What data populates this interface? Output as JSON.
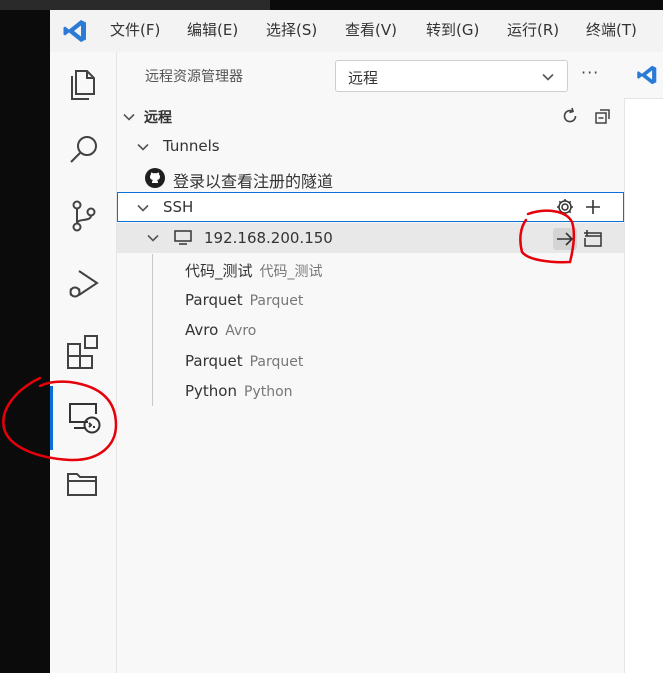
{
  "menu": {
    "file": "文件(F)",
    "edit": "编辑(E)",
    "selection": "选择(S)",
    "view": "查看(V)",
    "go": "转到(G)",
    "run": "运行(R)",
    "terminal": "终端(T)"
  },
  "sidebar": {
    "title": "远程资源管理器",
    "dropdown_value": "远程",
    "more": "···",
    "section_title": "远程",
    "tunnels": {
      "label": "Tunnels",
      "signin_text": "登录以查看注册的隧道"
    },
    "ssh": {
      "label": "SSH",
      "host": "192.168.200.150",
      "folders": [
        {
          "name": "代码_测试",
          "desc": "代码_测试"
        },
        {
          "name": "Parquet",
          "desc": "Parquet"
        },
        {
          "name": "Avro",
          "desc": "Avro"
        },
        {
          "name": "Parquet",
          "desc": "Parquet"
        },
        {
          "name": "Python",
          "desc": "Python"
        }
      ]
    }
  },
  "colors": {
    "accent": "#0a6fd6",
    "vscode_blue": "#2b7bd6",
    "annotation": "#e6000a"
  },
  "icons": [
    "vscode-logo-icon",
    "explorer-icon",
    "search-icon",
    "source-control-icon",
    "run-debug-icon",
    "extensions-icon",
    "remote-explorer-icon",
    "folder-icon",
    "chevron-down-icon",
    "refresh-icon",
    "collapse-all-icon",
    "github-icon",
    "gear-icon",
    "plus-icon",
    "monitor-icon",
    "connect-arrow-icon",
    "open-new-window-icon"
  ]
}
